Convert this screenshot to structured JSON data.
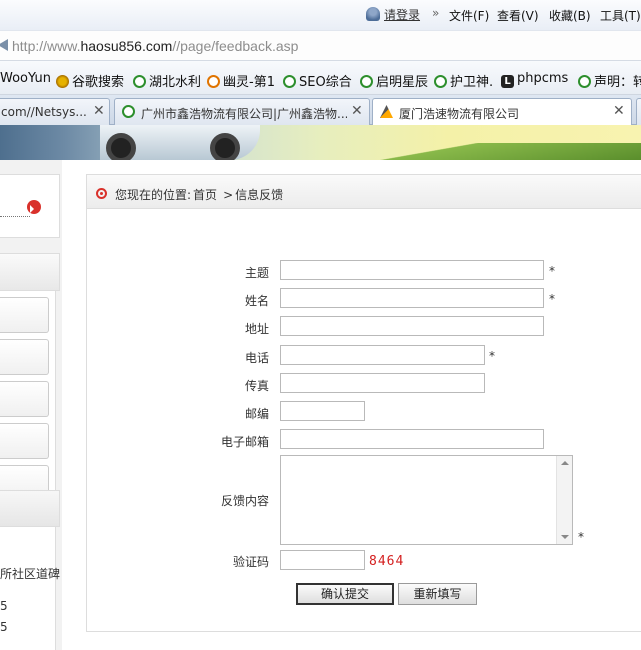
{
  "browser": {
    "login": "请登录",
    "double_arrow": "»",
    "menu": [
      "文件(F)",
      "查看(V)",
      "收藏(B)",
      "工具(T)"
    ],
    "url_prefix": "http://www.",
    "url_host": "haosu856.com",
    "url_path": "//page/feedback.asp",
    "favorites": [
      "WooYun",
      "谷歌搜索",
      "湖北水利",
      "幽灵-第1",
      "SEO综合",
      "启明星辰",
      "护卫神.",
      "phpcms",
      "声明：转"
    ],
    "tabs": [
      {
        "title": "com//Netsys...",
        "close": "✕"
      },
      {
        "title": "广州市鑫浩物流有限公司|广州鑫浩物...",
        "close": "✕"
      },
      {
        "title": "厦门浩速物流有限公司",
        "close": "✕",
        "active": true
      }
    ]
  },
  "left": {
    "text1": "所社区道碑",
    "text2": "5",
    "text3": "5"
  },
  "breadcrumb": {
    "prefix": "您现在的位置:",
    "home": "首页",
    "separator": ">",
    "current": "信息反馈"
  },
  "form": {
    "subject_label": "主题",
    "name_label": "姓名",
    "address_label": "地址",
    "phone_label": "电话",
    "fax_label": "传真",
    "zip_label": "邮编",
    "email_label": "电子邮箱",
    "content_label": "反馈内容",
    "captcha_label": "验证码",
    "captcha_value": "8464",
    "required_mark": "*",
    "submit_label": "确认提交",
    "reset_label": "重新填写"
  },
  "colors": {
    "accent_red": "#d9312b",
    "captcha_red": "#d42020"
  }
}
